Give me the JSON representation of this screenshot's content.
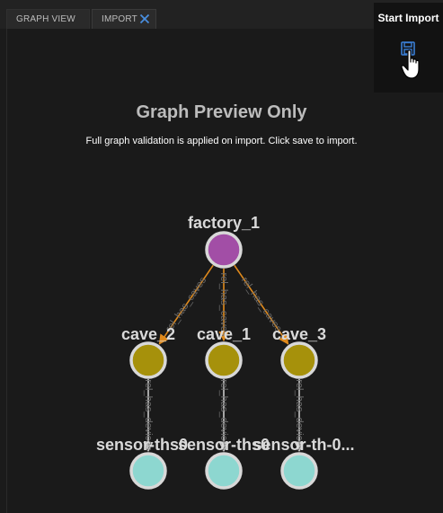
{
  "tabs": [
    {
      "label": "GRAPH VIEW",
      "active": false
    },
    {
      "label": "IMPORT",
      "active": true
    }
  ],
  "toolbar": {
    "start_import_label": "Start Import",
    "save_icon": "save-icon"
  },
  "preview": {
    "title": "Graph Preview Only",
    "subtitle": "Full graph validation is applied on import. Click save to import."
  },
  "graph": {
    "nodes": [
      {
        "id": "factory_1",
        "label": "factory_1",
        "color": "#a24ea6"
      },
      {
        "id": "cave_2",
        "label": "cave_2",
        "color": "#a6910b"
      },
      {
        "id": "cave_1",
        "label": "cave_1",
        "color": "#a6910b"
      },
      {
        "id": "cave_3",
        "label": "cave_3",
        "color": "#a6910b"
      },
      {
        "id": "sensor_a",
        "label": "sensor-ths0",
        "color": "#8dd7d0"
      },
      {
        "id": "sensor_b",
        "label": "sensor-ths0",
        "color": "#8dd7d0"
      },
      {
        "id": "sensor_c",
        "label": "sensor-th-0...",
        "color": "#8dd7d0"
      }
    ],
    "edges": [
      {
        "from": "factory_1",
        "to": "cave_2",
        "label": "rel_has_caves",
        "color": "#e08a1c"
      },
      {
        "from": "factory_1",
        "to": "cave_1",
        "label": "rel_has_caves",
        "color": "#e08a1c"
      },
      {
        "from": "factory_1",
        "to": "cave_3",
        "label": "rel_has_caves",
        "color": "#e08a1c"
      },
      {
        "from": "cave_2",
        "to": "sensor_a",
        "label": "rel_has_devices",
        "color": "#c8c8c8"
      },
      {
        "from": "cave_1",
        "to": "sensor_b",
        "label": "rel_has_devices",
        "color": "#c8c8c8"
      },
      {
        "from": "cave_3",
        "to": "sensor_c",
        "label": "rel_has_devices",
        "color": "#c8c8c8"
      }
    ]
  },
  "colors": {
    "accent": "#3b7fd6",
    "background": "#1a1a1a"
  }
}
